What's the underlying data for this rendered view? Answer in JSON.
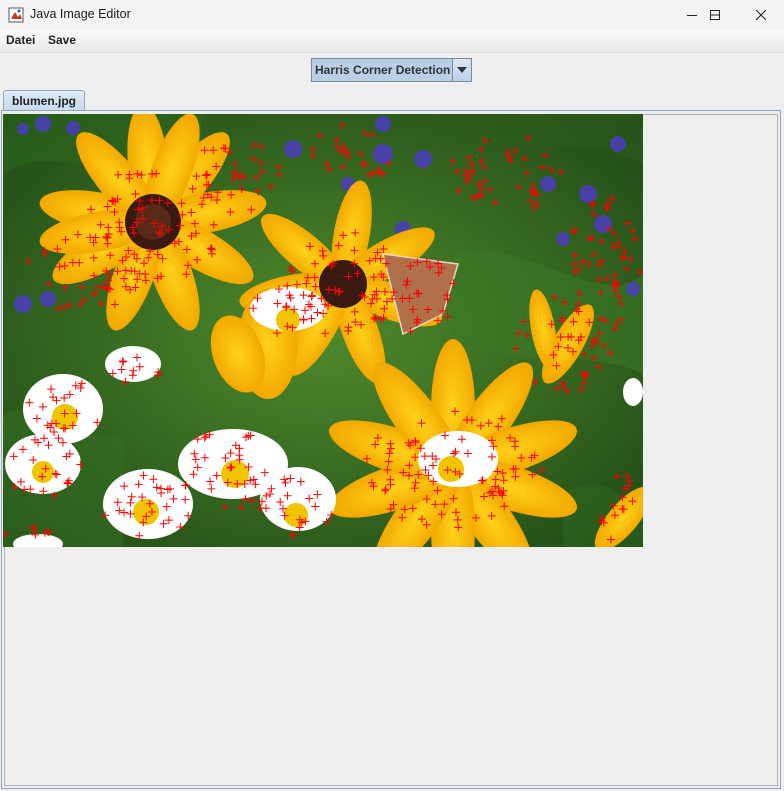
{
  "window": {
    "title": "Java Image Editor"
  },
  "menu": {
    "items": [
      "Datei",
      "Save"
    ]
  },
  "combo": {
    "selected": "Harris Corner Detection"
  },
  "tabs": [
    {
      "label": "blumen.jpg"
    }
  ],
  "image": {
    "alt": "blumen.jpg"
  },
  "colors": {
    "accent": "#b8cfe5",
    "corner_marker": "#ff0000"
  }
}
